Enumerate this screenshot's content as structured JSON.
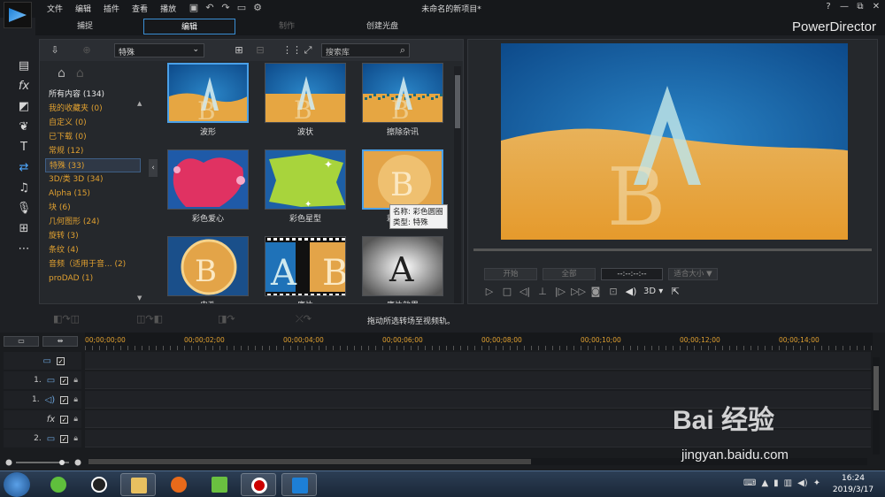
{
  "menu": [
    "文件",
    "编辑",
    "插件",
    "查看",
    "播放"
  ],
  "document_title": "未命名的新项目*",
  "brand": "PowerDirector",
  "window_controls": [
    "?",
    "—",
    "⧉",
    "✕"
  ],
  "modes": [
    {
      "label": "捕捉",
      "state": "normal"
    },
    {
      "label": "编辑",
      "state": "active"
    },
    {
      "label": "制作",
      "state": "dim"
    },
    {
      "label": "创建光盘",
      "state": "normal"
    }
  ],
  "library": {
    "category_value": "特殊",
    "search_placeholder": "搜索库",
    "categories": [
      {
        "label": "所有内容 (134)",
        "style": "white"
      },
      {
        "label": "我的收藏夹 (0)",
        "style": "orange"
      },
      {
        "label": "自定义 (0)",
        "style": "orange"
      },
      {
        "label": "已下载 (0)",
        "style": "orange"
      },
      {
        "label": "常规 (12)",
        "style": "orange"
      },
      {
        "label": "特殊 (33)",
        "style": "selected"
      },
      {
        "label": "3D/类 3D (34)",
        "style": "orange"
      },
      {
        "label": "Alpha (15)",
        "style": "orange"
      },
      {
        "label": "块 (6)",
        "style": "orange"
      },
      {
        "label": "几何图形 (24)",
        "style": "orange"
      },
      {
        "label": "旋转 (3)",
        "style": "orange"
      },
      {
        "label": "条纹 (4)",
        "style": "orange"
      },
      {
        "label": "音频（适用于音... (2)",
        "style": "orange"
      },
      {
        "label": "proDAD (1)",
        "style": "orange"
      }
    ],
    "tiles": [
      {
        "label": "波形",
        "kind": "wave",
        "selected": true
      },
      {
        "label": "波状",
        "kind": "wavy",
        "selected": false
      },
      {
        "label": "擦除杂讯",
        "kind": "noise",
        "selected": false
      },
      {
        "label": "彩色爱心",
        "kind": "heart",
        "selected": false
      },
      {
        "label": "彩色星型",
        "kind": "star",
        "selected": false
      },
      {
        "label": "彩色圆圈",
        "kind": "circleB",
        "selected": true
      },
      {
        "label": "电孔",
        "kind": "coin",
        "selected": false
      },
      {
        "label": "底片",
        "kind": "film",
        "selected": false
      },
      {
        "label": "底片效果",
        "kind": "vignette",
        "selected": false
      }
    ],
    "tooltip": {
      "line1": "名称: 彩色圆圈",
      "line2": "类型: 特殊"
    }
  },
  "preview": {
    "mark_in": "开始",
    "mark_out": "全部",
    "timecode": "--:--:--:--",
    "fit": "适合大小 ▼",
    "mode_3d": "3D ▾"
  },
  "edit_hint": "拖动所选转场至视频轨。",
  "timeline": {
    "ticks": [
      "00;00;00;00",
      "00;00;02;00",
      "00;00;04;00",
      "00;00;06;00",
      "00;00;08;00",
      "00;00;10;00",
      "00;00;12;00",
      "00;00;14;00"
    ],
    "tracks": [
      {
        "num": "",
        "icon": "video",
        "lock": false
      },
      {
        "num": "1.",
        "icon": "video",
        "lock": true
      },
      {
        "num": "1.",
        "icon": "audio",
        "lock": true
      },
      {
        "num": "",
        "icon": "fx",
        "lock": true
      },
      {
        "num": "2.",
        "icon": "video",
        "lock": true
      }
    ]
  },
  "taskbar": {
    "time": "16:24",
    "date": "2019/3/17"
  },
  "watermark": {
    "brand": "Bai 经验",
    "url": "jingyan.baidu.com"
  },
  "colors": {
    "accent": "#3b8fd4",
    "category_orange": "#e0a030",
    "tick_orange": "#e0a030"
  }
}
